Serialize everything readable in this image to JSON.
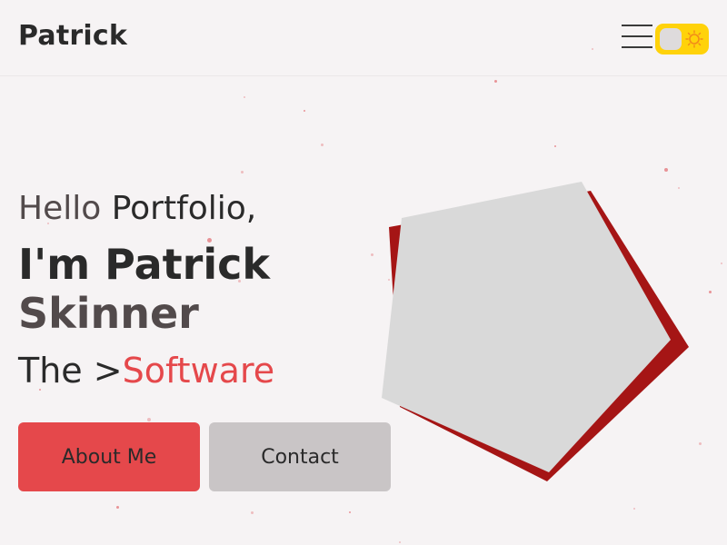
{
  "header": {
    "brand": "Patrick",
    "menu_icon": "hamburger-menu-icon",
    "theme_toggle": {
      "knob_icon": "toggle-knob",
      "sun_icon": "sun-icon",
      "accent_color": "#ffd20a"
    }
  },
  "hero": {
    "greeting": "Hello",
    "greeting_word": "Portfolio,",
    "name_line_1": "I'm Patrick",
    "name_line_2": "Skinner",
    "role_prefix": "The >",
    "role_word": "Software",
    "about_button": "About Me",
    "contact_button": "Contact"
  },
  "colors": {
    "background": "#f6f3f4",
    "accent": "#e5484b",
    "secondary_button": "#c9c5c6",
    "shape_fill": "#d9d9d9",
    "shape_shadow": "#a51515"
  }
}
